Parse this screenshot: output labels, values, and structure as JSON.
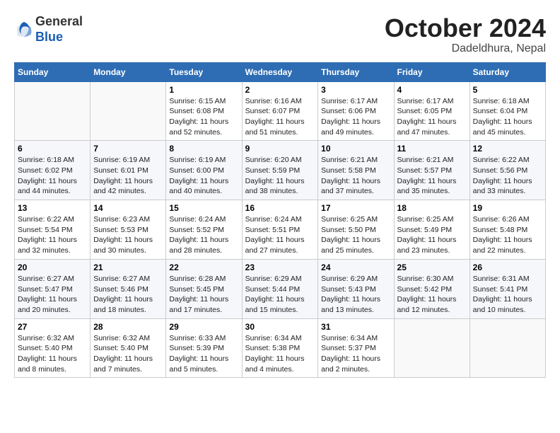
{
  "header": {
    "logo": {
      "general": "General",
      "blue": "Blue"
    },
    "title": "October 2024",
    "location": "Dadeldhura, Nepal"
  },
  "calendar": {
    "days_of_week": [
      "Sunday",
      "Monday",
      "Tuesday",
      "Wednesday",
      "Thursday",
      "Friday",
      "Saturday"
    ],
    "weeks": [
      [
        {
          "day": "",
          "content": ""
        },
        {
          "day": "",
          "content": ""
        },
        {
          "day": "1",
          "content": "Sunrise: 6:15 AM\nSunset: 6:08 PM\nDaylight: 11 hours and 52 minutes."
        },
        {
          "day": "2",
          "content": "Sunrise: 6:16 AM\nSunset: 6:07 PM\nDaylight: 11 hours and 51 minutes."
        },
        {
          "day": "3",
          "content": "Sunrise: 6:17 AM\nSunset: 6:06 PM\nDaylight: 11 hours and 49 minutes."
        },
        {
          "day": "4",
          "content": "Sunrise: 6:17 AM\nSunset: 6:05 PM\nDaylight: 11 hours and 47 minutes."
        },
        {
          "day": "5",
          "content": "Sunrise: 6:18 AM\nSunset: 6:04 PM\nDaylight: 11 hours and 45 minutes."
        }
      ],
      [
        {
          "day": "6",
          "content": "Sunrise: 6:18 AM\nSunset: 6:02 PM\nDaylight: 11 hours and 44 minutes."
        },
        {
          "day": "7",
          "content": "Sunrise: 6:19 AM\nSunset: 6:01 PM\nDaylight: 11 hours and 42 minutes."
        },
        {
          "day": "8",
          "content": "Sunrise: 6:19 AM\nSunset: 6:00 PM\nDaylight: 11 hours and 40 minutes."
        },
        {
          "day": "9",
          "content": "Sunrise: 6:20 AM\nSunset: 5:59 PM\nDaylight: 11 hours and 38 minutes."
        },
        {
          "day": "10",
          "content": "Sunrise: 6:21 AM\nSunset: 5:58 PM\nDaylight: 11 hours and 37 minutes."
        },
        {
          "day": "11",
          "content": "Sunrise: 6:21 AM\nSunset: 5:57 PM\nDaylight: 11 hours and 35 minutes."
        },
        {
          "day": "12",
          "content": "Sunrise: 6:22 AM\nSunset: 5:56 PM\nDaylight: 11 hours and 33 minutes."
        }
      ],
      [
        {
          "day": "13",
          "content": "Sunrise: 6:22 AM\nSunset: 5:54 PM\nDaylight: 11 hours and 32 minutes."
        },
        {
          "day": "14",
          "content": "Sunrise: 6:23 AM\nSunset: 5:53 PM\nDaylight: 11 hours and 30 minutes."
        },
        {
          "day": "15",
          "content": "Sunrise: 6:24 AM\nSunset: 5:52 PM\nDaylight: 11 hours and 28 minutes."
        },
        {
          "day": "16",
          "content": "Sunrise: 6:24 AM\nSunset: 5:51 PM\nDaylight: 11 hours and 27 minutes."
        },
        {
          "day": "17",
          "content": "Sunrise: 6:25 AM\nSunset: 5:50 PM\nDaylight: 11 hours and 25 minutes."
        },
        {
          "day": "18",
          "content": "Sunrise: 6:25 AM\nSunset: 5:49 PM\nDaylight: 11 hours and 23 minutes."
        },
        {
          "day": "19",
          "content": "Sunrise: 6:26 AM\nSunset: 5:48 PM\nDaylight: 11 hours and 22 minutes."
        }
      ],
      [
        {
          "day": "20",
          "content": "Sunrise: 6:27 AM\nSunset: 5:47 PM\nDaylight: 11 hours and 20 minutes."
        },
        {
          "day": "21",
          "content": "Sunrise: 6:27 AM\nSunset: 5:46 PM\nDaylight: 11 hours and 18 minutes."
        },
        {
          "day": "22",
          "content": "Sunrise: 6:28 AM\nSunset: 5:45 PM\nDaylight: 11 hours and 17 minutes."
        },
        {
          "day": "23",
          "content": "Sunrise: 6:29 AM\nSunset: 5:44 PM\nDaylight: 11 hours and 15 minutes."
        },
        {
          "day": "24",
          "content": "Sunrise: 6:29 AM\nSunset: 5:43 PM\nDaylight: 11 hours and 13 minutes."
        },
        {
          "day": "25",
          "content": "Sunrise: 6:30 AM\nSunset: 5:42 PM\nDaylight: 11 hours and 12 minutes."
        },
        {
          "day": "26",
          "content": "Sunrise: 6:31 AM\nSunset: 5:41 PM\nDaylight: 11 hours and 10 minutes."
        }
      ],
      [
        {
          "day": "27",
          "content": "Sunrise: 6:32 AM\nSunset: 5:40 PM\nDaylight: 11 hours and 8 minutes."
        },
        {
          "day": "28",
          "content": "Sunrise: 6:32 AM\nSunset: 5:40 PM\nDaylight: 11 hours and 7 minutes."
        },
        {
          "day": "29",
          "content": "Sunrise: 6:33 AM\nSunset: 5:39 PM\nDaylight: 11 hours and 5 minutes."
        },
        {
          "day": "30",
          "content": "Sunrise: 6:34 AM\nSunset: 5:38 PM\nDaylight: 11 hours and 4 minutes."
        },
        {
          "day": "31",
          "content": "Sunrise: 6:34 AM\nSunset: 5:37 PM\nDaylight: 11 hours and 2 minutes."
        },
        {
          "day": "",
          "content": ""
        },
        {
          "day": "",
          "content": ""
        }
      ]
    ]
  }
}
